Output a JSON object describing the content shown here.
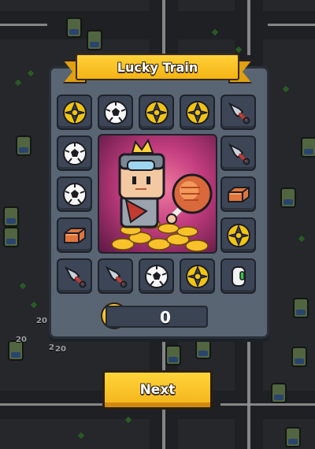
{
  "title": "Lucky Train",
  "coin_count": "0",
  "next_label": "Next",
  "background_damage_numbers": [
    "20",
    "20",
    "20",
    "2"
  ],
  "grid_items": [
    {
      "name": "shuriken-item",
      "icon": "shuriken"
    },
    {
      "name": "soccer-ball-item",
      "icon": "soccer-ball"
    },
    {
      "name": "shuriken-item",
      "icon": "shuriken"
    },
    {
      "name": "shuriken-item",
      "icon": "shuriken"
    },
    {
      "name": "kunai-item",
      "icon": "kunai"
    },
    {
      "name": "kunai-item",
      "icon": "kunai"
    },
    {
      "name": "brick-item",
      "icon": "brick"
    },
    {
      "name": "shuriken-item",
      "icon": "shuriken"
    },
    {
      "name": "pill-item",
      "icon": "pill"
    },
    {
      "name": "shuriken-item",
      "icon": "shuriken"
    },
    {
      "name": "soccer-ball-item",
      "icon": "soccer-ball"
    },
    {
      "name": "kunai-item",
      "icon": "kunai"
    },
    {
      "name": "kunai-item",
      "icon": "kunai"
    },
    {
      "name": "brick-item",
      "icon": "brick"
    },
    {
      "name": "soccer-ball-item",
      "icon": "soccer-ball"
    },
    {
      "name": "soccer-ball-item",
      "icon": "soccer-ball"
    }
  ],
  "hero_icon": "crowned-hero-with-meat-and-coins",
  "colors": {
    "accent_yellow": "#f4b414",
    "panel": "#5a6574",
    "cell": "#3c4656",
    "hero_bg": "#c23c7e"
  }
}
